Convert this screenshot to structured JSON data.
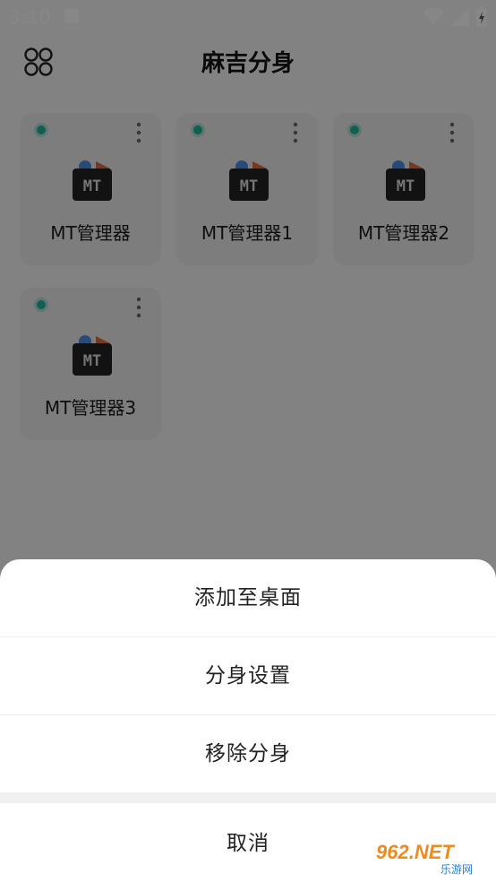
{
  "status_bar": {
    "time": "3:10",
    "icons": [
      "notification-square-icon",
      "wifi-icon",
      "signal-icon",
      "battery-charging-icon"
    ]
  },
  "app_bar": {
    "title": "麻吉分身",
    "left_icon": "apps-grid-icon"
  },
  "clones": [
    {
      "label": "MT管理器",
      "active_color": "#1fb59a"
    },
    {
      "label": "MT管理器1",
      "active_color": "#1fb59a"
    },
    {
      "label": "MT管理器2",
      "active_color": "#1fb59a"
    },
    {
      "label": "MT管理器3",
      "active_color": "#1fb59a"
    }
  ],
  "bottom_sheet": {
    "items": [
      {
        "label": "添加至桌面"
      },
      {
        "label": "分身设置"
      },
      {
        "label": "移除分身"
      }
    ],
    "cancel_label": "取消"
  },
  "watermark": {
    "brand": "962.NET",
    "subtitle": "乐游网"
  },
  "colors": {
    "accent": "#1fb59a",
    "overlay": "rgba(0,0,0,0.47)",
    "sheet_bg": "#ffffff"
  }
}
